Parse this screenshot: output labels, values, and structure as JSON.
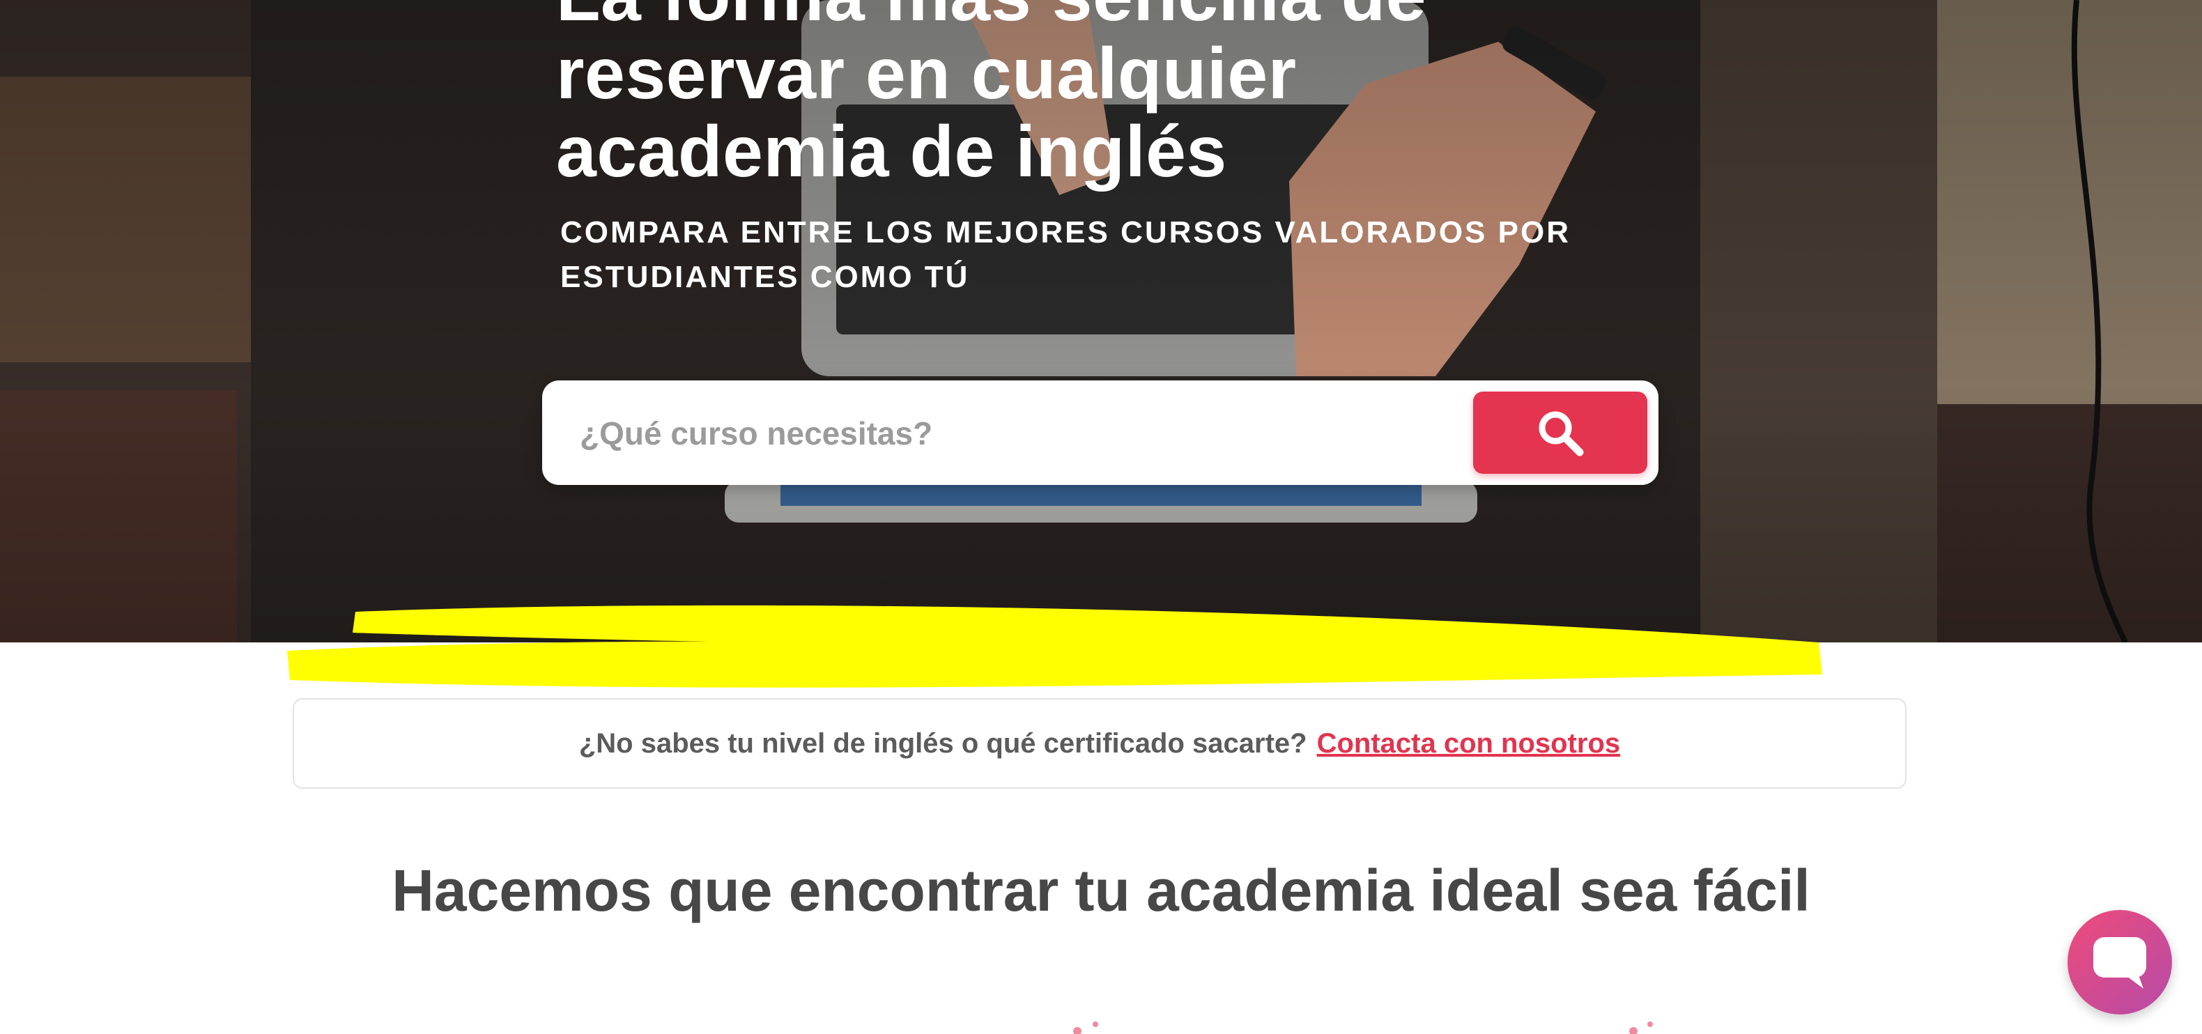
{
  "hero": {
    "title": "La forma más sencilla de reservar en cualquier academia de inglés",
    "subtitle": "Compara entre los mejores cursos valorados por estudiantes como tú"
  },
  "search": {
    "placeholder": "¿Qué curso necesitas?",
    "button_icon": "search-icon"
  },
  "info": {
    "question": "¿No sabes tu nivel de inglés o qué certificado sacarte?",
    "link_label": "Contacta con nosotros"
  },
  "section": {
    "title": "Hacemos que encontrar tu academia ideal sea fácil"
  },
  "chat": {
    "icon": "chat-icon"
  },
  "colors": {
    "accent": "#e5344f",
    "highlight": "#ffff00",
    "heading": "#474747",
    "text": "#5b5b5b"
  }
}
